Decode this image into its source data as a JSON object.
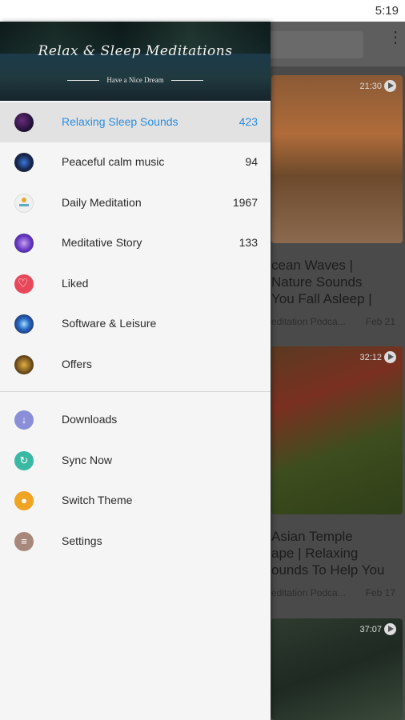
{
  "status_bar": {
    "time": "5:19"
  },
  "drawer": {
    "header": {
      "title": "Relax & Sleep  Meditations",
      "subtitle": "Have a Nice Dream"
    },
    "items": [
      {
        "label": "Relaxing Sleep Sounds",
        "count": "423",
        "icon": "relaxing-sleep-sounds-avatar",
        "selected": true
      },
      {
        "label": "Peaceful calm music",
        "count": "94",
        "icon": "peaceful-calm-music-avatar"
      },
      {
        "label": "Daily Meditation",
        "count": "1967",
        "icon": "daily-meditation-avatar"
      },
      {
        "label": "Meditative Story",
        "count": "133",
        "icon": "meditative-story-avatar"
      },
      {
        "label": "Liked",
        "icon": "heart-icon"
      },
      {
        "label": "Software & Leisure",
        "icon": "software-leisure-avatar"
      },
      {
        "label": "Offers",
        "icon": "offers-avatar"
      }
    ],
    "secondary_items": [
      {
        "label": "Downloads",
        "icon": "download-icon"
      },
      {
        "label": "Sync Now",
        "icon": "sync-icon"
      },
      {
        "label": "Switch Theme",
        "icon": "theme-drop-icon"
      },
      {
        "label": "Settings",
        "icon": "settings-sliders-icon"
      }
    ]
  },
  "background_feed": {
    "cards": [
      {
        "duration": "21:30",
        "title_lines": [
          "cean Waves |",
          "Nature Sounds",
          "You Fall Asleep |"
        ],
        "source": "editation Podca...",
        "date": "Feb 21"
      },
      {
        "duration": "32:12",
        "title_lines": [
          "Asian Temple",
          "ape | Relaxing",
          "ounds To Help You"
        ],
        "source": "editation Podca...",
        "date": "Feb 17"
      },
      {
        "duration": "37:07"
      }
    ]
  },
  "colors": {
    "accent": "#2a8ce0",
    "selected_bg": "#e2e2e2",
    "drawer_bg": "#f5f5f5"
  }
}
